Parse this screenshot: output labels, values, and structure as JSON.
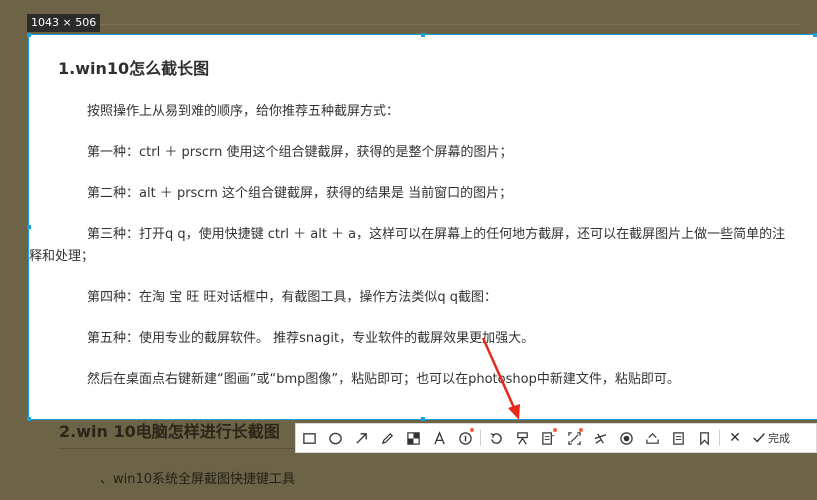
{
  "capture": {
    "size_label": "1043 × 506"
  },
  "article": {
    "title": "1.win10怎么截长图",
    "intro": "按照操作上从易到难的顺序，给你推荐五种截屏方式：",
    "methods": [
      "第一种：ctrl ＋ prscrn 使用这个组合键截屏，获得的是整个屏幕的图片；",
      "第二种：alt ＋ prscrn 这个组合键截屏，获得的结果是 当前窗口的图片；",
      "第三种：打开q q，使用快捷键 ctrl ＋ alt ＋ a，这样可以在屏幕上的任何地方截屏，还可以在截屏图片上做一些简单的注释和处理；",
      "第四种：在淘 宝 旺 旺对话框中，有截图工具，操作方法类似q q截图：",
      "第五种：使用专业的截屏软件。 推荐snagit，专业软件的截屏效果更加强大。"
    ],
    "outro": "然后在桌面点右键新建“图画”或“bmp图像”，粘贴即可；也可以在photoshop中新建文件，粘贴即可。",
    "next_title": "2.win 10电脑怎样进行长截图",
    "next_text": "、win10系统全屏截图快捷键工具"
  },
  "toolbar": {
    "tools": [
      {
        "icon": "rectangle-icon"
      },
      {
        "icon": "ellipse-icon"
      },
      {
        "icon": "arrow-icon"
      },
      {
        "icon": "pen-icon"
      },
      {
        "icon": "mosaic-icon"
      },
      {
        "icon": "text-icon"
      },
      {
        "icon": "number-icon"
      },
      {
        "icon": "undo-icon"
      },
      {
        "icon": "pin-icon"
      },
      {
        "icon": "ocr-icon"
      },
      {
        "icon": "long-screenshot-icon"
      },
      {
        "icon": "translate-icon"
      },
      {
        "icon": "record-icon"
      },
      {
        "icon": "share-icon"
      },
      {
        "icon": "save-icon"
      },
      {
        "icon": "bookmark-icon"
      }
    ],
    "close_label": "✕",
    "done_label": "完成",
    "accent": "#1aa0d8",
    "arrow_color": "#e8291c"
  }
}
